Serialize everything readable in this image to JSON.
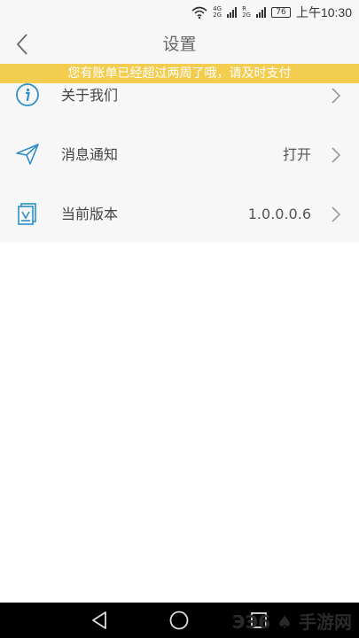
{
  "status_bar": {
    "network_top": "4G",
    "network_bottom": "2G",
    "sim2_top": "R",
    "sim2_bottom": "2G",
    "battery": "76",
    "time": "上午10:30"
  },
  "header": {
    "title": "设置",
    "back_icon": "chevron-left-icon"
  },
  "notice": {
    "text": "您有账单已经超过两周了哦，请及时支付",
    "bg_color": "#f2cd4f"
  },
  "settings": {
    "items": [
      {
        "label": "关于我们",
        "value": "",
        "icon": "info-icon"
      },
      {
        "label": "消息通知",
        "value": "打开",
        "icon": "paper-plane-icon"
      },
      {
        "label": "当前版本",
        "value": "1.0.0.0.6",
        "icon": "version-icon"
      }
    ]
  },
  "colors": {
    "icon_blue": "#2e8fc9",
    "chevron_gray": "#999999"
  },
  "system_nav": {
    "watermark": "ЭЭ6 ♠ 手游网"
  }
}
